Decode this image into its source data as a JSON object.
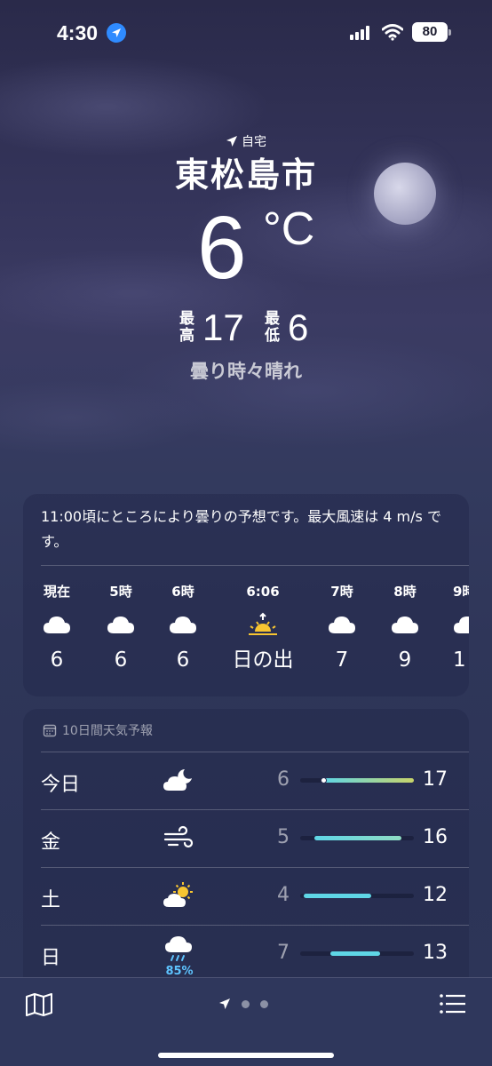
{
  "status_bar": {
    "time": "4:30",
    "battery": "80"
  },
  "location": {
    "home_label": "自宅",
    "city": "東松島市",
    "temperature": "6",
    "unit": "°C",
    "high_label_1": "最",
    "high_label_2": "高",
    "high": "17",
    "low_label_1": "最",
    "low_label_2": "低",
    "low": "6",
    "condition": "曇り時々晴れ"
  },
  "hourly": {
    "summary": "11:00頃にところにより曇りの予想です。最大風速は 4 m/s です。",
    "items": [
      {
        "time": "現在",
        "icon": "cloud-icon",
        "temp": "6"
      },
      {
        "time": "5時",
        "icon": "cloud-icon",
        "temp": "6"
      },
      {
        "time": "6時",
        "icon": "cloud-icon",
        "temp": "6"
      },
      {
        "time": "6:06",
        "icon": "sunrise-icon",
        "temp": "日の出"
      },
      {
        "time": "7時",
        "icon": "cloud-icon",
        "temp": "7"
      },
      {
        "time": "8時",
        "icon": "cloud-icon",
        "temp": "9"
      },
      {
        "time": "9時",
        "icon": "cloud-icon",
        "temp": "1"
      }
    ]
  },
  "daily": {
    "header": "10日間天気予報",
    "days": [
      {
        "name": "今日",
        "icon": "cloud-moon-icon",
        "low": "6",
        "high": "17",
        "pop": ""
      },
      {
        "name": "金",
        "icon": "wind-icon",
        "low": "5",
        "high": "16",
        "pop": ""
      },
      {
        "name": "土",
        "icon": "cloud-sun-icon",
        "low": "4",
        "high": "12",
        "pop": ""
      },
      {
        "name": "日",
        "icon": "cloud-rain-icon",
        "low": "7",
        "high": "13",
        "pop": "85%"
      }
    ]
  },
  "colors": {
    "accent_blue": "#2f8bff",
    "bar_cool": "#5fd6e6",
    "bar_warm": "#c8d46a",
    "precip": "#5ec4ff",
    "sun": "#f7c531"
  }
}
